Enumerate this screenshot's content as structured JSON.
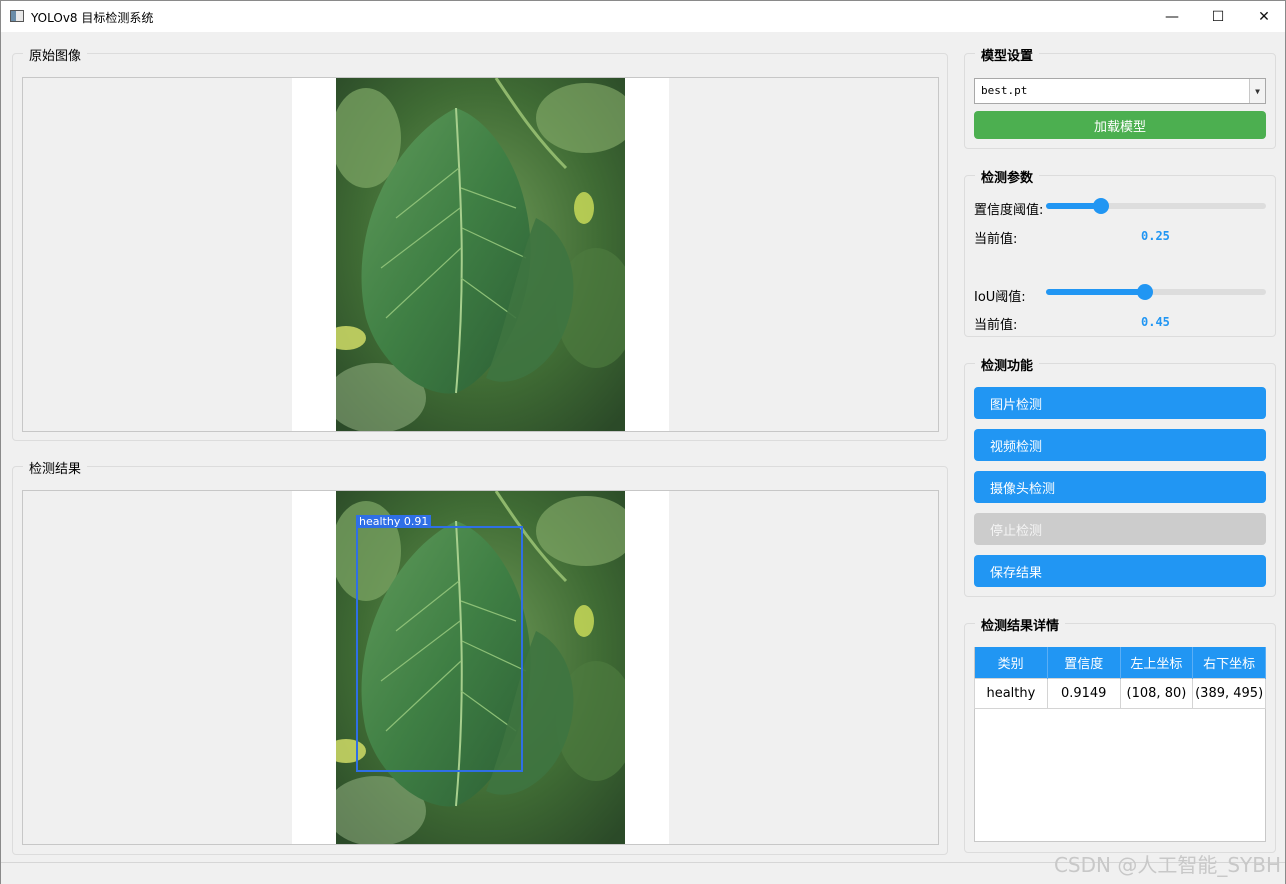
{
  "window": {
    "title": "YOLOv8 目标检测系统",
    "controls": [
      "—",
      "☐",
      "✕"
    ]
  },
  "original_group": {
    "title": "原始图像"
  },
  "result_group": {
    "title": "检测结果"
  },
  "detection_overlay": {
    "label": "healthy  0.91"
  },
  "model_settings": {
    "title": "模型设置",
    "selected_model": "best.pt",
    "load_button": "加载模型"
  },
  "params": {
    "title": "检测参数",
    "confidence": {
      "label": "置信度阈值:",
      "current_label": "当前值:",
      "value": "0.25",
      "fraction": 0.25
    },
    "iou": {
      "label": "IoU阈值:",
      "current_label": "当前值:",
      "value": "0.45",
      "fraction": 0.45
    }
  },
  "functions": {
    "title": "检测功能",
    "buttons": [
      "图片检测",
      "视频检测",
      "摄像头检测",
      "停止检测",
      "保存结果"
    ]
  },
  "details": {
    "title": "检测结果详情",
    "columns": [
      "类别",
      "置信度",
      "左上坐标",
      "右下坐标"
    ],
    "rows": [
      [
        "healthy",
        "0.9149",
        "(108, 80)",
        "(389, 495)"
      ]
    ]
  },
  "watermark": "CSDN @人工智能_SYBH",
  "colors": {
    "accent": "#2196f3",
    "load": "#4caf50",
    "disabled": "#cccccc",
    "box": "#2f6fe6"
  }
}
